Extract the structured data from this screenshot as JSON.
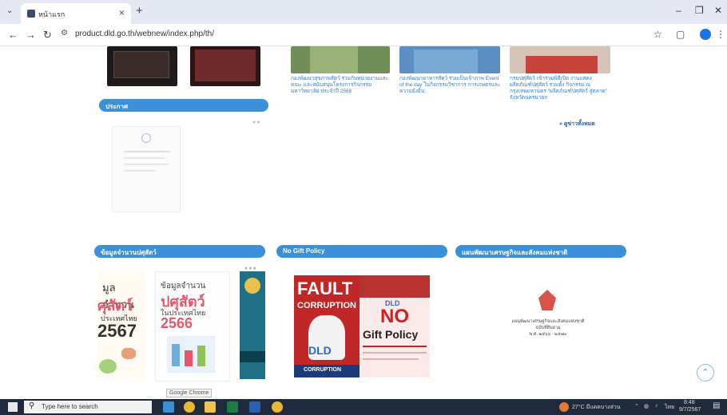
{
  "browser": {
    "tab_title": "หน้าแรก",
    "url": "product.dld.go.th/webnew/index.php/th/"
  },
  "news": [
    {
      "caption": "กองพัฒนาสุขภาพสัตว์ ร่วมกับหน่วยงานและคณะ และสนับสนุนโครงการกิจกรรม มหาวิทยาลัย ประจำปี 2568"
    },
    {
      "caption": "กองพัฒนาอาหารสัตว์ ร่วมเป็นเจ้าภาพ Event of the day ในกิจกรรมวิชาการ การเกษตรและความยั่งยืน"
    },
    {
      "caption": "กรมปศุสัตว์ เข้าร่วมพิธีเปิด งานแสดงผลิตภัณฑ์ปศุสัตว์ รวมทั้ง กิจกรรม ณ กรุงเทพมหานคร \"ผลิตภัณฑ์ปศุสัตว์ สู่ตลาด\" จังหวัดนครนายก"
    }
  ],
  "links": {
    "all_news": "» ดูข่าวทั้งหมด"
  },
  "sections": {
    "announcement": "ประกาศ",
    "livestock_data": "ข้อมูลจำนวนปศุสัตว์",
    "no_gift": "No Gift Policy",
    "national_plan": "แผนพัฒนาเศรษฐกิจและสังคมแห่งชาติ"
  },
  "books": {
    "book1_line1": "มูลจำนวน",
    "book1_line2": "ศุสัตว์",
    "book1_line3": "ประเทศไทย",
    "book1_year": "2567",
    "book2_line1": "ข้อมูลจำนวน",
    "book2_line2": "ปศุสัตว์",
    "book2_line3": "ในประเทศไทย",
    "book2_year": "2566"
  },
  "nogift": {
    "word1": "FAULT",
    "word2": "CORRUPTION",
    "brand": "DLD",
    "no": "NO",
    "gift_policy": "Gift Policy",
    "bottom": "CORRUPTION"
  },
  "plan_doc": {
    "title": "แผนพัฒนาเศรษฐกิจและสังคมแห่งชาติ",
    "sub": "ฉบับที่สิบสาม",
    "years": "พ.ศ. ๒๕๖๖ - ๒๕๗๐"
  },
  "tooltip": "Google Chrome",
  "taskbar": {
    "search_placeholder": "Type here to search",
    "weather": "27°C มีแดดบางส่วน",
    "lang": "ไทย",
    "time": "8:48",
    "date": "9/7/2567"
  }
}
